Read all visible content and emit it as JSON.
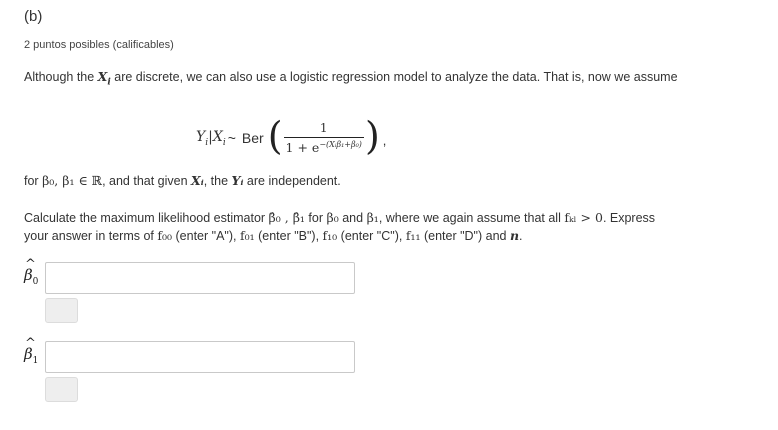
{
  "part_label": "(b)",
  "points_text": "2 puntos posibles (calificables)",
  "intro": {
    "before": "Although the ",
    "var": "X",
    "sub": "i",
    "after": " are discrete, we can also use a logistic regression model to analyze the data. That is, now we assume"
  },
  "equation": {
    "lhs": "Y",
    "lhs_sub": "i",
    "given": "|X",
    "given_sub": "i",
    "sim": " ~ ",
    "dist": "Ber",
    "numerator": "1",
    "denominator_base": "1 + e",
    "denominator_exp": "−(Xᵢβ₁+β₀)",
    "trailing": ","
  },
  "condition": {
    "t1": "for ",
    "params": "β₀, β₁ ∈ ℝ",
    "t2": ", and that given ",
    "xvar": "Xᵢ",
    "t3": ", the ",
    "yvar": "Yᵢ",
    "t4": " are independent."
  },
  "question": {
    "line1_a": "Calculate the maximum likelihood estimator ",
    "est": "β̂₀ , β̂₁",
    "line1_b": " for ",
    "b0": "β₀",
    "line1_c": " and ",
    "b1": "β₁",
    "line1_d": ", where we again assume that all ",
    "fkl": "fₖₗ > 0",
    "line1_e": ". Express",
    "line2_a": "your answer in terms of ",
    "f00": "f₀₀",
    "line2_b": " (enter \"A\"), ",
    "f01": "f₀₁",
    "line2_c": " (enter \"B\"), ",
    "f10": "f₁₀",
    "line2_d": " (enter \"C\"), ",
    "f11": "f₁₁",
    "line2_e": " (enter \"D\") and ",
    "n": "n",
    "line2_f": "."
  },
  "answers": [
    {
      "symbol": "β",
      "hat": "^",
      "sub": "0",
      "value": ""
    },
    {
      "symbol": "β",
      "hat": "^",
      "sub": "1",
      "value": ""
    }
  ]
}
